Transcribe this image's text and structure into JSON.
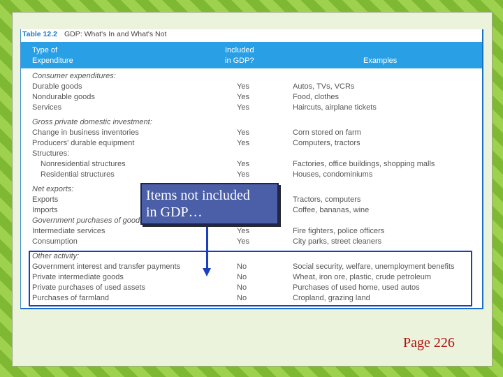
{
  "table": {
    "number": "Table 12.2",
    "title": "GDP: What's In and What's Not",
    "headers": {
      "type": [
        "Type of",
        "Expenditure"
      ],
      "included": [
        "Included",
        "in GDP?"
      ],
      "examples": "Examples"
    },
    "rows": [
      {
        "expenditure": "Consumer expenditures:",
        "included": "",
        "examples": "",
        "style": "ital"
      },
      {
        "expenditure": "Durable goods",
        "included": "Yes",
        "examples": "Autos, TVs, VCRs",
        "style": ""
      },
      {
        "expenditure": "Nondurable goods",
        "included": "Yes",
        "examples": "Food, clothes",
        "style": ""
      },
      {
        "expenditure": "Services",
        "included": "Yes",
        "examples": "Haircuts, airplane tickets",
        "style": ""
      },
      {
        "expenditure": "Gross private domestic investment:",
        "included": "",
        "examples": "",
        "style": "ital"
      },
      {
        "expenditure": "Change in business inventories",
        "included": "Yes",
        "examples": "Corn stored on farm",
        "style": ""
      },
      {
        "expenditure": "Producers' durable equipment",
        "included": "Yes",
        "examples": "Computers, tractors",
        "style": ""
      },
      {
        "expenditure": "Structures:",
        "included": "",
        "examples": "",
        "style": ""
      },
      {
        "expenditure": "Nonresidential structures",
        "included": "Yes",
        "examples": "Factories, office buildings, shopping malls",
        "style": "ind"
      },
      {
        "expenditure": "Residential structures",
        "included": "Yes",
        "examples": "Houses, condominiums",
        "style": "ind"
      },
      {
        "expenditure": "Net exports:",
        "included": "",
        "examples": "",
        "style": "ital"
      },
      {
        "expenditure": "Exports",
        "included": "Yes",
        "examples": "Tractors, computers",
        "style": ""
      },
      {
        "expenditure": "Imports",
        "included": "Yes",
        "examples": "Coffee, bananas, wine",
        "style": ""
      },
      {
        "expenditure": "Government purchases of goods",
        "included": "",
        "examples": "",
        "style": "ital"
      },
      {
        "expenditure": "Intermediate services",
        "included": "Yes",
        "examples": "Fire fighters, police officers",
        "style": ""
      },
      {
        "expenditure": "Consumption",
        "included": "Yes",
        "examples": "City parks, street cleaners",
        "style": ""
      },
      {
        "expenditure": "Other activity:",
        "included": "",
        "examples": "",
        "style": "ital"
      },
      {
        "expenditure": "Government interest and transfer payments",
        "included": "No",
        "examples": "Social security, welfare, unemployment benefits",
        "style": ""
      },
      {
        "expenditure": "Private intermediate goods",
        "included": "No",
        "examples": "Wheat, iron ore, plastic, crude petroleum",
        "style": ""
      },
      {
        "expenditure": "Private purchases of used assets",
        "included": "No",
        "examples": "Purchases of used home, used autos",
        "style": ""
      },
      {
        "expenditure": "Purchases of farmland",
        "included": "No",
        "examples": "Cropland, grazing land",
        "style": ""
      }
    ]
  },
  "callout": {
    "line1": "Items not included",
    "line2": "in GDP…"
  },
  "page_label": "Page 226",
  "colors": {
    "header_bg": "#29a0e6",
    "highlight": "#1a3fbf",
    "callout_bg": "#4b5ea8",
    "page_label": "#b01010"
  }
}
